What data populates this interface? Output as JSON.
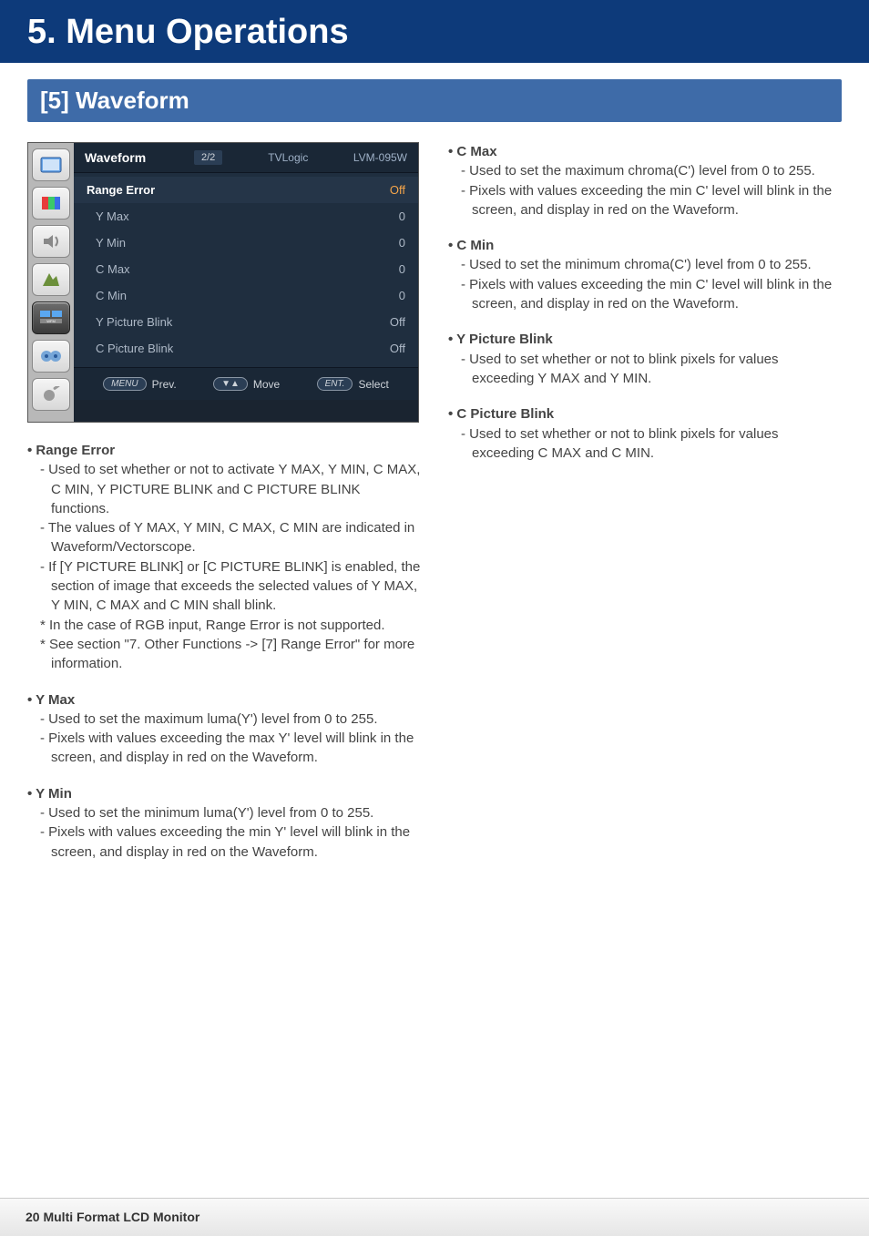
{
  "banner": {
    "title": "5. Menu Operations",
    "subtitle": "[5] Waveform"
  },
  "menu": {
    "title": "Waveform",
    "page": "2/2",
    "brand": "TVLogic",
    "model": "LVM-095W",
    "rows": [
      {
        "label": "Range Error",
        "val": "Off",
        "header": true
      },
      {
        "label": "Y Max",
        "val": "0"
      },
      {
        "label": "Y Min",
        "val": "0"
      },
      {
        "label": "C Max",
        "val": "0"
      },
      {
        "label": "C Min",
        "val": "0"
      },
      {
        "label": "Y Picture Blink",
        "val": "Off"
      },
      {
        "label": "C Picture Blink",
        "val": "Off"
      }
    ],
    "footer": {
      "prev_key": "MENU",
      "prev_label": "Prev.",
      "move_key": "▼▲",
      "move_label": "Move",
      "select_key": "ENT.",
      "select_label": "Select"
    }
  },
  "left": [
    {
      "h": "Range Error",
      "lines": [
        "- Used to set whether or not to activate Y MAX, Y MIN, C MAX, C MIN, Y PICTURE BLINK and C PICTURE BLINK functions.",
        "- The values of Y MAX, Y MIN, C MAX, C MIN are indicated in Waveform/Vectorscope.",
        "- If [Y PICTURE BLINK] or [C PICTURE BLINK] is enabled, the section of image that exceeds the selected values of Y MAX, Y MIN, C MAX and C MIN shall blink.",
        "* In the case of RGB input, Range Error is not supported.",
        "* See section \"7. Other Functions -> [7] Range Error\" for more information."
      ]
    },
    {
      "h": "Y Max",
      "lines": [
        "- Used to set the maximum luma(Y') level from 0 to 255.",
        "- Pixels with values exceeding the max Y' level will blink in the screen, and display in red on the Waveform."
      ]
    },
    {
      "h": "Y Min",
      "lines": [
        "- Used to set the minimum luma(Y') level from 0 to 255.",
        "- Pixels with values exceeding the min Y' level will blink in the screen, and display in red on the Waveform."
      ]
    }
  ],
  "right": [
    {
      "h": "C Max",
      "lines": [
        "- Used to set the maximum chroma(C') level from 0 to 255.",
        "- Pixels with values exceeding the min C' level will blink in the screen, and display in red on the Waveform."
      ]
    },
    {
      "h": "C Min",
      "lines": [
        "- Used to set the minimum chroma(C') level from 0 to 255.",
        "- Pixels with values exceeding the min C' level will blink in the screen, and display in red on the Waveform."
      ]
    },
    {
      "h": "Y Picture Blink",
      "lines": [
        "- Used to set whether or not to blink pixels for values exceeding Y MAX and Y MIN."
      ]
    },
    {
      "h": "C Picture Blink",
      "lines": [
        "- Used to set whether or not to blink pixels for values exceeding C MAX and C MIN."
      ]
    }
  ],
  "footer": {
    "text": "20 Multi Format LCD Monitor"
  }
}
